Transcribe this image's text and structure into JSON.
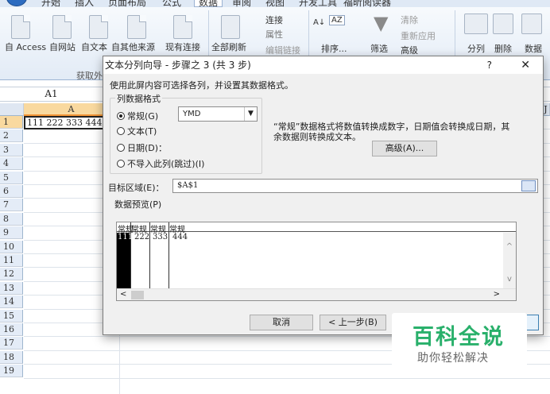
{
  "ribbon": {
    "tabs": [
      "开始",
      "插入",
      "页面布局",
      "公式",
      "数据",
      "审阅",
      "视图",
      "开发工具",
      "福昕阅读器"
    ],
    "active_tab": "数据",
    "get_external": [
      "自 Access",
      "自网站",
      "自文本",
      "自其他来源",
      "现有连接"
    ],
    "get_external_group": "获取外",
    "refresh_all": "全部刷新",
    "connections": [
      "连接",
      "属性",
      "编辑链接"
    ],
    "sort_label": "排序...",
    "filter_label": "筛选",
    "filter_items": [
      "清除",
      "重新应用",
      "高级"
    ],
    "text_to_columns": "分列",
    "remove_duplicates": "删除",
    "data_validation": "数据"
  },
  "formula_bar": {
    "name_box": "A1"
  },
  "sheet": {
    "columns": [
      "A",
      "J"
    ],
    "rows": [
      "1",
      "2",
      "3",
      "4",
      "5",
      "6",
      "7",
      "8",
      "9",
      "10",
      "11",
      "12",
      "13",
      "14",
      "15",
      "16",
      "17",
      "18",
      "19"
    ],
    "a1_value": "111 222 333 444"
  },
  "dialog": {
    "title": "文本分列向导 - 步骤之 3 (共 3 步)",
    "help": "?",
    "close": "✕",
    "instruction": "使用此屏内容可选择各列，并设置其数据格式。",
    "format_group": "列数据格式",
    "radios": [
      "常规(G)",
      "文本(T)",
      "日期(D)：",
      "不导入此列(跳过)(I)"
    ],
    "selected_radio": "常规(G)",
    "date_format": "YMD",
    "desc_line1": "“常规”数据格式将数值转换成数字，日期值会转换成日期，其",
    "desc_line2": "余数据则转换成文本。",
    "advanced_btn": "高级(A)...",
    "dest_label": "目标区域(E)：",
    "dest_value": "$A$1",
    "preview_label": "数据预览(P)",
    "preview_headers": [
      "常规",
      "常规",
      "常规",
      "常规"
    ],
    "preview_values": [
      "111",
      "222",
      "333",
      "444"
    ],
    "cancel_btn": "取消",
    "back_btn": "< 上一步(B)"
  },
  "watermark": {
    "line1": "百科全说",
    "line2": "助你轻松解决"
  },
  "colors": {
    "ribbon_bg": "#e2ebf6",
    "selection": "#f9d99f",
    "watermark_green": "#29b06b"
  }
}
